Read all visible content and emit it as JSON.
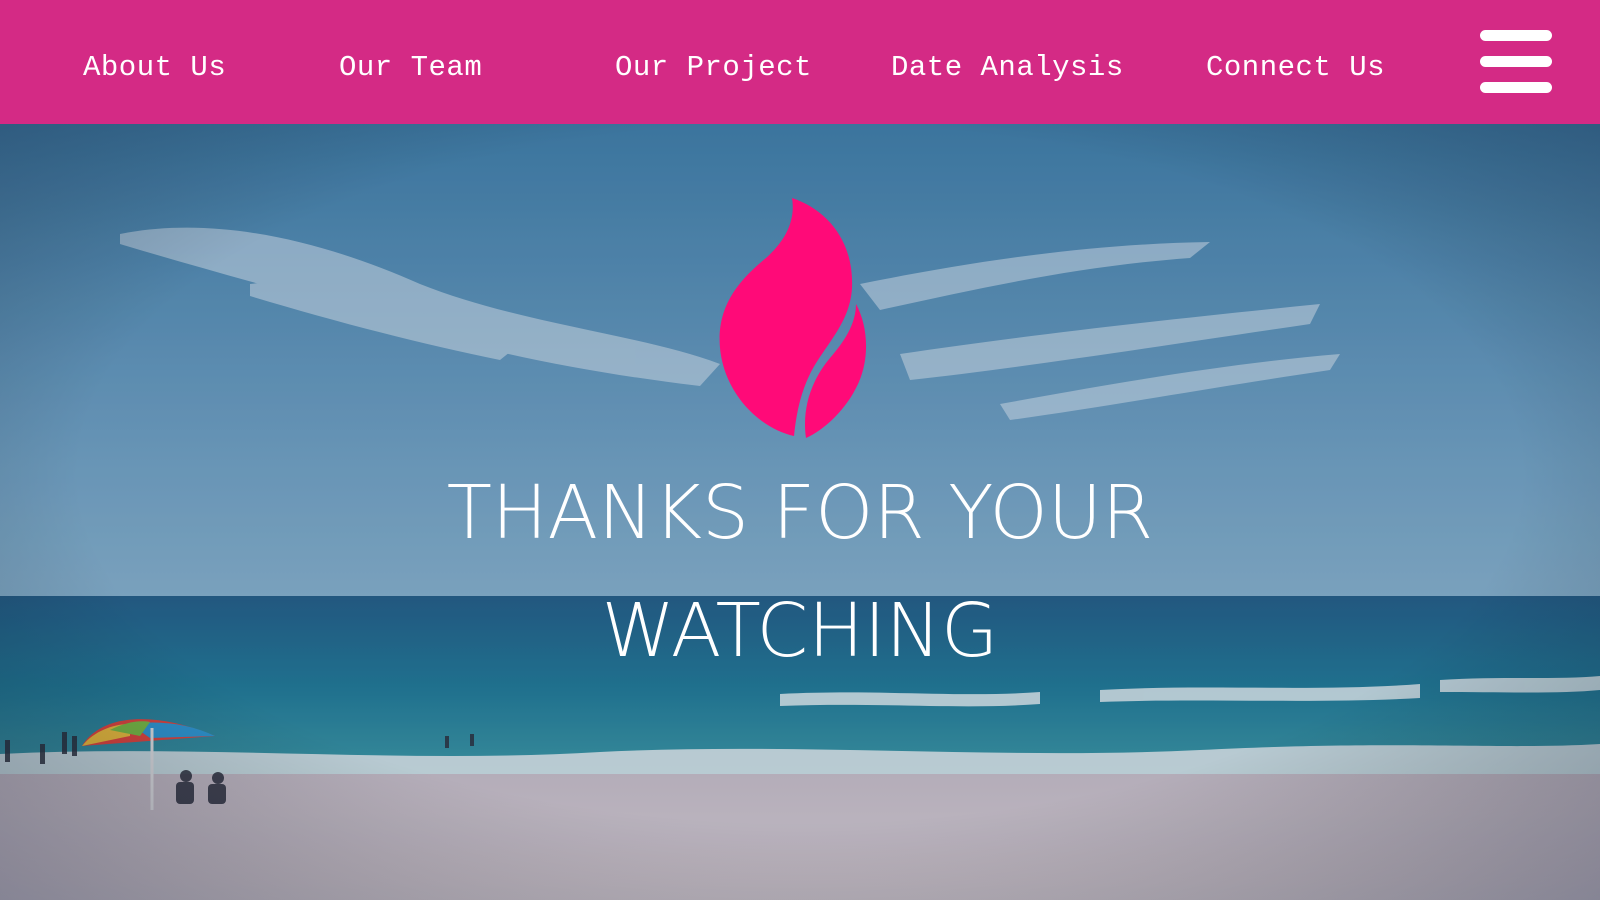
{
  "nav": {
    "items": [
      {
        "label": "About Us"
      },
      {
        "label": "Our Team"
      },
      {
        "label": "Our Project"
      },
      {
        "label": "Date Analysis"
      },
      {
        "label": "Connect Us"
      }
    ],
    "menu_icon": "hamburger-menu-icon",
    "background_color": "#d42a85"
  },
  "hero": {
    "logo_icon": "flame-icon",
    "logo_color": "#ff0a78",
    "headline_line1": "THANKS FOR YOUR",
    "headline_line2": "WATCHING",
    "background_scene": "beach-photo"
  }
}
